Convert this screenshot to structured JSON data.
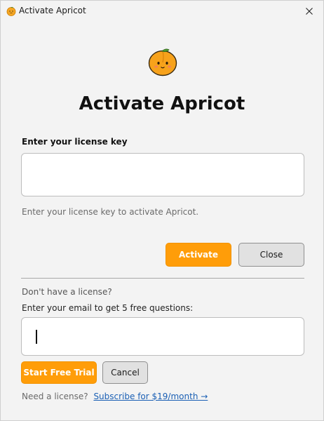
{
  "window": {
    "title": "Activate Apricot"
  },
  "icons": {
    "app": "apricot-icon",
    "close": "close-icon",
    "logo": "apricot-logo-icon"
  },
  "colors": {
    "accent": "#ff9d09",
    "link": "#1a5fb4",
    "background": "#f3f3f3"
  },
  "main": {
    "heading": "Activate Apricot",
    "license_label": "Enter your license key",
    "license_value": "",
    "license_helper": "Enter your license key to activate Apricot.",
    "activate_label": "Activate",
    "close_label": "Close"
  },
  "trial": {
    "no_license_text": "Don't have a license?",
    "email_prompt": "Enter your email to get 5 free questions:",
    "email_value": "",
    "start_trial_label": "Start Free Trial",
    "cancel_label": "Cancel"
  },
  "footer": {
    "need_license_text": "Need a license?",
    "subscribe_link": "Subscribe for $19/month →"
  }
}
